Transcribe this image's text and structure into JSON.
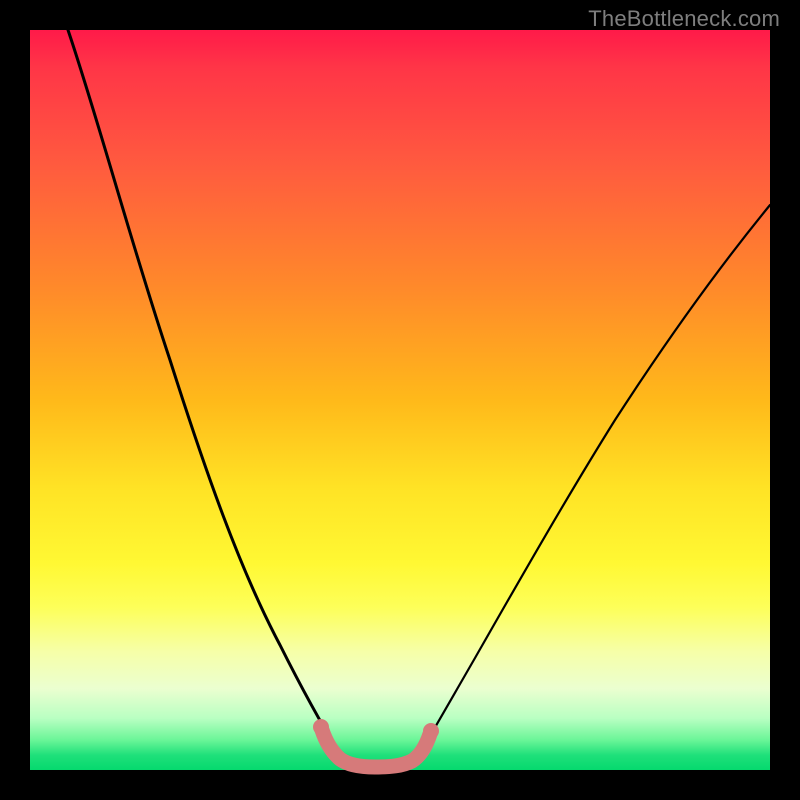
{
  "watermark": "TheBottleneck.com",
  "chart_data": {
    "type": "line",
    "title": "",
    "xlabel": "",
    "ylabel": "",
    "xlim": [
      0,
      100
    ],
    "ylim": [
      0,
      100
    ],
    "series": [
      {
        "name": "left-curve",
        "x": [
          5,
          8,
          12,
          16,
          20,
          24,
          28,
          32,
          35,
          37,
          39,
          41
        ],
        "y": [
          100,
          90,
          77,
          63,
          50,
          37,
          25,
          14,
          7,
          3,
          1,
          0
        ]
      },
      {
        "name": "right-curve",
        "x": [
          50,
          52,
          55,
          59,
          64,
          70,
          76,
          82,
          88,
          94,
          100
        ],
        "y": [
          0,
          2,
          6,
          12,
          21,
          32,
          43,
          53,
          62,
          70,
          76
        ]
      },
      {
        "name": "valley-marker",
        "x": [
          39,
          40,
          41,
          42,
          44,
          46,
          48,
          49,
          50,
          51,
          52
        ],
        "y": [
          4,
          2,
          1,
          0.5,
          0.3,
          0.3,
          0.5,
          1,
          2,
          3,
          5
        ]
      }
    ],
    "colors": {
      "curve": "#000000",
      "marker": "#d67a7a",
      "gradient_top": "#ff1a49",
      "gradient_bottom": "#05d96e"
    }
  }
}
